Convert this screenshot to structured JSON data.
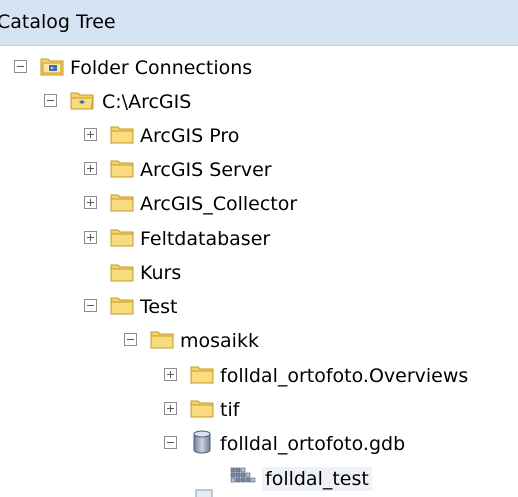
{
  "panel": {
    "title": "Catalog Tree"
  },
  "tree": {
    "folder_connections": "Folder Connections",
    "arcgis_root": "C:\\ArcGIS",
    "arcgis_pro": "ArcGIS Pro",
    "arcgis_server": "ArcGIS Server",
    "arcgis_collector": "ArcGIS_Collector",
    "feltdatabaser": "Feltdatabaser",
    "kurs": "Kurs",
    "test": "Test",
    "mosaikk": "mosaikk",
    "overviews": "folldal_ortofoto.Overviews",
    "tif": "tif",
    "gdb": "folldal_ortofoto.gdb",
    "folldal_test": "folldal_test"
  },
  "icons": {
    "folder": "folder-icon",
    "folder_connection": "folder-connection-icon",
    "geodatabase": "geodatabase-icon",
    "raster": "raster-dataset-icon"
  },
  "colors": {
    "title_bar": "#d6e3f2",
    "folder_fill": "#f3d36b",
    "folder_stroke": "#c69a25"
  }
}
